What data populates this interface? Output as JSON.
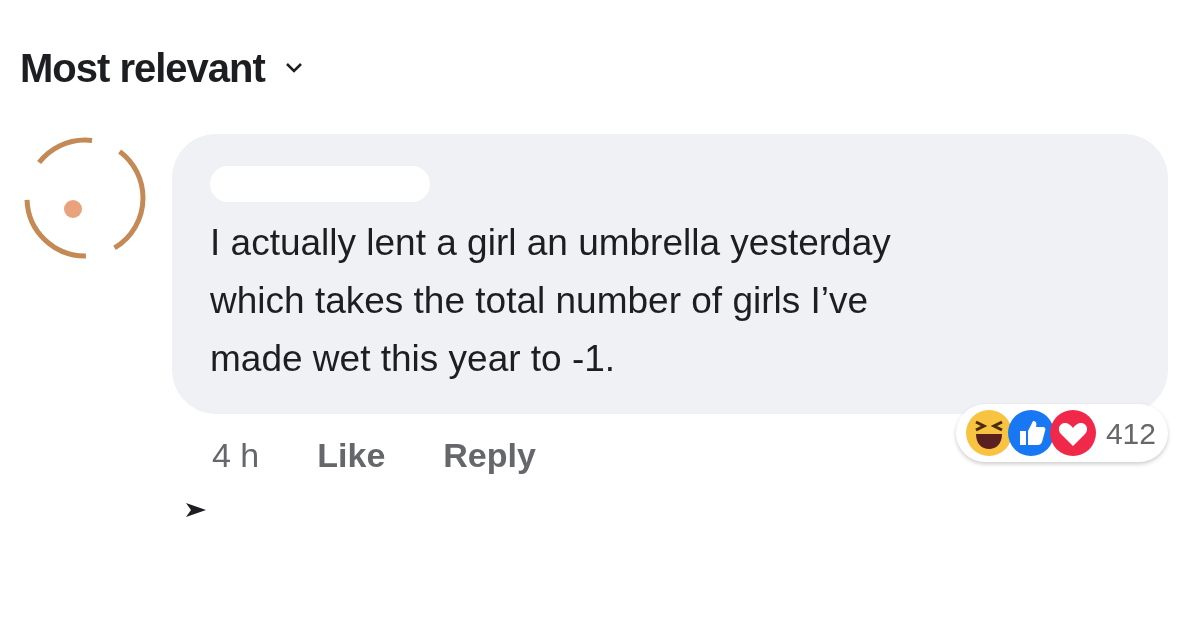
{
  "sort_menu": {
    "label": "Most relevant"
  },
  "comment": {
    "text": "I actually lent a girl an umbrella yesterday which takes the total number of girls I’ve made wet this year to -1.",
    "time": "4 h",
    "actions": [
      "Like",
      "Reply"
    ],
    "reaction_count": "412"
  }
}
